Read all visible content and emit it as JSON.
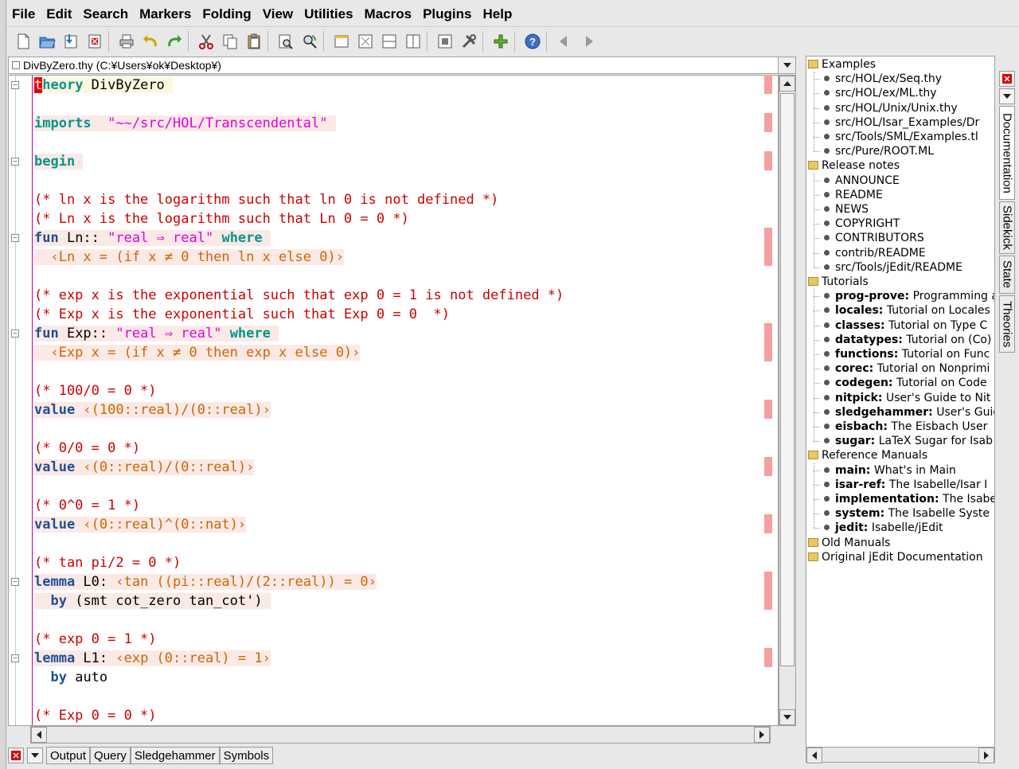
{
  "menubar": [
    "File",
    "Edit",
    "Search",
    "Markers",
    "Folding",
    "View",
    "Utilities",
    "Macros",
    "Plugins",
    "Help"
  ],
  "toolbar": {
    "icons": [
      "new-file-icon",
      "open-file-icon",
      "save-icon",
      "close-icon",
      "print-icon",
      "undo-icon",
      "redo-icon",
      "cut-icon",
      "copy-icon",
      "paste-icon",
      "find-icon",
      "replace-icon",
      "new-view-icon",
      "unsplit-icon",
      "split-horizontal-icon",
      "split-vertical-icon",
      "buffer-options-icon",
      "global-options-icon",
      "plugin-manager-icon",
      "help-icon",
      "back-icon",
      "forward-icon"
    ]
  },
  "buffer": {
    "title": "DivByZero.thy (C:¥Users¥ok¥Desktop¥)"
  },
  "code_lines": [
    {
      "segments": [
        {
          "t": "t",
          "c": "cur"
        },
        {
          "t": "heory",
          "c": "kw"
        },
        {
          "t": " DivByZero ",
          "c": ""
        }
      ],
      "bg": "bgy",
      "fold": "minus"
    },
    {
      "segments": [
        {
          "t": "",
          "c": ""
        }
      ],
      "fold": "end"
    },
    {
      "segments": [
        {
          "t": "imports",
          "c": "kw"
        },
        {
          "t": "  ",
          "c": ""
        },
        {
          "t": "\"~~/src/HOL/Transcendental\"",
          "c": "st"
        },
        {
          "t": " ",
          "c": ""
        }
      ],
      "bg": "bg"
    },
    {
      "segments": [
        {
          "t": "",
          "c": ""
        }
      ]
    },
    {
      "segments": [
        {
          "t": "begin",
          "c": "kw"
        },
        {
          "t": " ",
          "c": ""
        }
      ],
      "bg": "bg",
      "fold": "minus"
    },
    {
      "segments": [
        {
          "t": "",
          "c": ""
        }
      ]
    },
    {
      "segments": [
        {
          "t": "(* ln x is the logarithm such that ln 0 is not defined *)",
          "c": "cm"
        }
      ]
    },
    {
      "segments": [
        {
          "t": "(* Ln x is the logarithm such that Ln 0 = 0 *)",
          "c": "cm"
        }
      ]
    },
    {
      "segments": [
        {
          "t": "fun",
          "c": "kw3"
        },
        {
          "t": " Ln:: ",
          "c": ""
        },
        {
          "t": "\"real ⇒ real\"",
          "c": "st"
        },
        {
          "t": " ",
          "c": ""
        },
        {
          "t": "where",
          "c": "kw"
        },
        {
          "t": " ",
          "c": ""
        }
      ],
      "bg": "bg",
      "fold": "minus"
    },
    {
      "segments": [
        {
          "t": "  ‹Ln x = (if x ≠ 0 then ln x else 0)›",
          "c": "ct"
        }
      ],
      "bg": "bg"
    },
    {
      "segments": [
        {
          "t": "",
          "c": ""
        }
      ]
    },
    {
      "segments": [
        {
          "t": "(* exp x is the exponential such that exp 0 = 1 is not defined *)",
          "c": "cm"
        }
      ]
    },
    {
      "segments": [
        {
          "t": "(* Exp x is the exponential such that Exp 0 = 0  *)",
          "c": "cm"
        }
      ]
    },
    {
      "segments": [
        {
          "t": "fun",
          "c": "kw3"
        },
        {
          "t": " Exp:: ",
          "c": ""
        },
        {
          "t": "\"real ⇒ real\"",
          "c": "st"
        },
        {
          "t": " ",
          "c": ""
        },
        {
          "t": "where",
          "c": "kw"
        },
        {
          "t": " ",
          "c": ""
        }
      ],
      "bg": "bg",
      "fold": "minus"
    },
    {
      "segments": [
        {
          "t": "  ‹Exp x = (if x ≠ 0 then exp x else 0)›",
          "c": "ct"
        }
      ],
      "bg": "bg"
    },
    {
      "segments": [
        {
          "t": "",
          "c": ""
        }
      ]
    },
    {
      "segments": [
        {
          "t": "(* 100/0 = 0 *)",
          "c": "cm"
        }
      ]
    },
    {
      "segments": [
        {
          "t": "value",
          "c": "kw3"
        },
        {
          "t": " ",
          "c": ""
        },
        {
          "t": "‹(100::real)/(0::real)›",
          "c": "ct"
        }
      ],
      "bg": "bg"
    },
    {
      "segments": [
        {
          "t": "",
          "c": ""
        }
      ]
    },
    {
      "segments": [
        {
          "t": "(* 0/0 = 0 *)",
          "c": "cm"
        }
      ]
    },
    {
      "segments": [
        {
          "t": "value",
          "c": "kw3"
        },
        {
          "t": " ",
          "c": ""
        },
        {
          "t": "‹(0::real)/(0::real)›",
          "c": "ct"
        }
      ],
      "bg": "bg"
    },
    {
      "segments": [
        {
          "t": "",
          "c": ""
        }
      ]
    },
    {
      "segments": [
        {
          "t": "(* 0^0 = 1 *)",
          "c": "cm"
        }
      ]
    },
    {
      "segments": [
        {
          "t": "value",
          "c": "kw3"
        },
        {
          "t": " ",
          "c": ""
        },
        {
          "t": "‹(0::real)^(0::nat)›",
          "c": "ct"
        }
      ],
      "bg": "bg"
    },
    {
      "segments": [
        {
          "t": "",
          "c": ""
        }
      ]
    },
    {
      "segments": [
        {
          "t": "(* tan pi/2 = 0 *)",
          "c": "cm"
        }
      ]
    },
    {
      "segments": [
        {
          "t": "lemma",
          "c": "kw3"
        },
        {
          "t": " L0: ",
          "c": ""
        },
        {
          "t": "‹tan ((pi::real)/(2::real)) = 0›",
          "c": "ct"
        }
      ],
      "bg": "bg",
      "fold": "minus"
    },
    {
      "segments": [
        {
          "t": "  ",
          "c": ""
        },
        {
          "t": "by",
          "c": "kw3"
        },
        {
          "t": " (smt cot_zero tan_cot') ",
          "c": ""
        }
      ],
      "bg": "bg"
    },
    {
      "segments": [
        {
          "t": "",
          "c": ""
        }
      ]
    },
    {
      "segments": [
        {
          "t": "(* exp 0 = 1 *)",
          "c": "cm"
        }
      ]
    },
    {
      "segments": [
        {
          "t": "lemma",
          "c": "kw3"
        },
        {
          "t": " L1: ",
          "c": ""
        },
        {
          "t": "‹exp (0::real) = 1›",
          "c": "ct"
        }
      ],
      "bg": "bg",
      "fold": "minus"
    },
    {
      "segments": [
        {
          "t": "  ",
          "c": ""
        },
        {
          "t": "by",
          "c": "kw3"
        },
        {
          "t": " auto ",
          "c": ""
        }
      ]
    },
    {
      "segments": [
        {
          "t": "",
          "c": ""
        }
      ]
    },
    {
      "segments": [
        {
          "t": "(* Exp 0 = 0 *)",
          "c": "cm"
        }
      ]
    }
  ],
  "bottom_tabs": [
    "Output",
    "Query",
    "Sledgehammer",
    "Symbols"
  ],
  "side_tabs": [
    "Documentation",
    "Sidekick",
    "State",
    "Theories"
  ],
  "doc_tree": [
    {
      "type": "folder",
      "label": "Examples"
    },
    {
      "type": "item",
      "label": "src/HOL/ex/Seq.thy"
    },
    {
      "type": "item",
      "label": "src/HOL/ex/ML.thy"
    },
    {
      "type": "item",
      "label": "src/HOL/Unix/Unix.thy"
    },
    {
      "type": "item",
      "label": "src/HOL/Isar_Examples/Dr"
    },
    {
      "type": "item",
      "label": "src/Tools/SML/Examples.tl"
    },
    {
      "type": "item",
      "label": "src/Pure/ROOT.ML"
    },
    {
      "type": "folder",
      "label": "Release notes"
    },
    {
      "type": "item",
      "label": "ANNOUNCE"
    },
    {
      "type": "item",
      "label": "README"
    },
    {
      "type": "item",
      "label": "NEWS"
    },
    {
      "type": "item",
      "label": "COPYRIGHT"
    },
    {
      "type": "item",
      "label": "CONTRIBUTORS"
    },
    {
      "type": "item",
      "label": "contrib/README"
    },
    {
      "type": "item",
      "label": "src/Tools/jEdit/README"
    },
    {
      "type": "folder",
      "label": "Tutorials"
    },
    {
      "type": "item",
      "bold": "prog-prove:",
      "label": " Programming a"
    },
    {
      "type": "item",
      "bold": "locales:",
      "label": " Tutorial on Locales"
    },
    {
      "type": "item",
      "bold": "classes:",
      "label": " Tutorial on Type C"
    },
    {
      "type": "item",
      "bold": "datatypes:",
      "label": " Tutorial on (Co)"
    },
    {
      "type": "item",
      "bold": "functions:",
      "label": " Tutorial on Func"
    },
    {
      "type": "item",
      "bold": "corec:",
      "label": " Tutorial on Nonprimi"
    },
    {
      "type": "item",
      "bold": "codegen:",
      "label": " Tutorial on Code"
    },
    {
      "type": "item",
      "bold": "nitpick:",
      "label": " User's Guide to Nit"
    },
    {
      "type": "item",
      "bold": "sledgehammer:",
      "label": " User's Guid"
    },
    {
      "type": "item",
      "bold": "eisbach:",
      "label": " The Eisbach User"
    },
    {
      "type": "item",
      "bold": "sugar:",
      "label": " LaTeX Sugar for Isab"
    },
    {
      "type": "folder",
      "label": "Reference Manuals"
    },
    {
      "type": "item",
      "bold": "main:",
      "label": " What's in Main"
    },
    {
      "type": "item",
      "bold": "isar-ref:",
      "label": " The Isabelle/Isar I"
    },
    {
      "type": "item",
      "bold": "implementation:",
      "label": " The Isabe"
    },
    {
      "type": "item",
      "bold": "system:",
      "label": " The Isabelle Syste"
    },
    {
      "type": "item",
      "bold": "jedit:",
      "label": " Isabelle/jEdit"
    },
    {
      "type": "folder",
      "label": "Old Manuals"
    },
    {
      "type": "folder",
      "label": "Original jEdit Documentation"
    }
  ],
  "colors": {
    "keyword": "#00968a",
    "command": "#1f4e96",
    "comment": "#cc0000",
    "string": "#e000e0",
    "cartouche": "#cc6600",
    "error_marker": "#f4a0a0"
  }
}
